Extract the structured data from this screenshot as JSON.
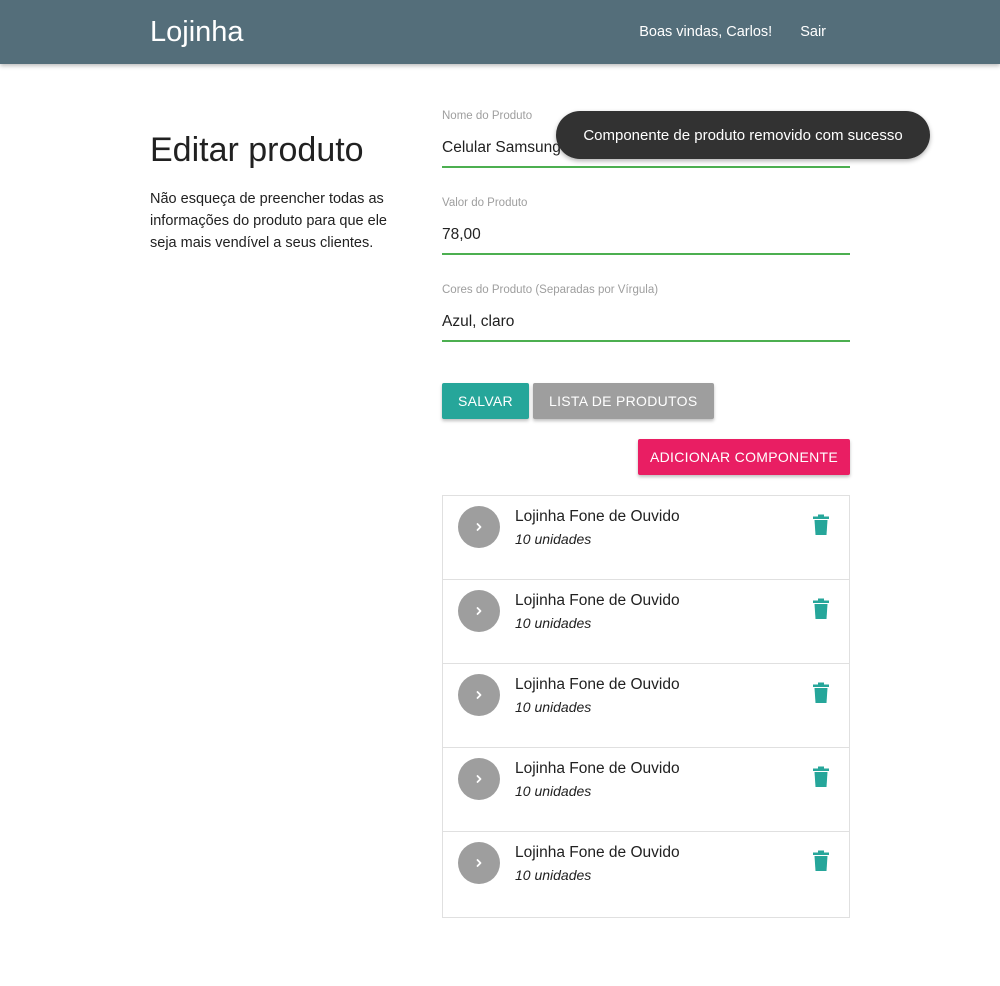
{
  "navbar": {
    "brand": "Lojinha",
    "links": [
      "Boas vindas, Carlos!",
      "Sair"
    ]
  },
  "page": {
    "title": "Editar produto",
    "description": "Não esqueça de preencher todas as informações do produto para que ele seja mais vendível a seus clientes."
  },
  "form": {
    "fields": [
      {
        "label": "Nome do Produto",
        "value": "Celular Samsung"
      },
      {
        "label": "Valor do Produto",
        "value": "78,00"
      },
      {
        "label": "Cores do Produto (Separadas por Vírgula)",
        "value": "Azul, claro"
      }
    ],
    "save_label": "Salvar",
    "list_label": "Lista de Produtos",
    "add_component_label": "Adicionar Componente"
  },
  "components": [
    {
      "name": "Lojinha Fone de Ouvido",
      "quantity": "10 unidades"
    },
    {
      "name": "Lojinha Fone de Ouvido",
      "quantity": "10 unidades"
    },
    {
      "name": "Lojinha Fone de Ouvido",
      "quantity": "10 unidades"
    },
    {
      "name": "Lojinha Fone de Ouvido",
      "quantity": "10 unidades"
    },
    {
      "name": "Lojinha Fone de Ouvido",
      "quantity": "10 unidades"
    }
  ],
  "toast": {
    "message": "Componente de produto removido com sucesso"
  },
  "colors": {
    "navbar": "#546e7a",
    "save": "#26a69a",
    "list": "#9e9e9e",
    "add": "#e91e63",
    "input_underline": "#4caf50",
    "trash": "#26a69a",
    "toast": "#323232"
  },
  "icons": {
    "avatar": "chevron-right-icon",
    "delete": "trash-icon"
  }
}
